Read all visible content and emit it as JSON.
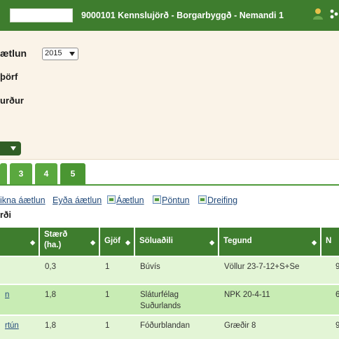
{
  "topbar": {
    "title": "9000101 Kennslujörð - Borgarbyggð - Nemandi 1",
    "user_icon": "user-icon",
    "menu_icon": "menu-icon"
  },
  "panel": {
    "plan_label": "ætlun",
    "year_value": "2015",
    "need_label": "þörf",
    "result_label": "urður"
  },
  "tabs": [
    "3",
    "4",
    "5"
  ],
  "tab_partial": "",
  "links": [
    {
      "label": "ikna áætlun",
      "icon": null
    },
    {
      "label": "Eyða áætlun",
      "icon": null
    },
    {
      "label": "Áætlun",
      "icon": "excel-icon"
    },
    {
      "label": "Pöntun",
      "icon": "excel-icon"
    },
    {
      "label": "Dreifing",
      "icon": "excel-icon"
    }
  ],
  "section_label": "rði",
  "table": {
    "headers": [
      "",
      "Stærð (ha.)",
      "Gjöf",
      "Söluaðili",
      "Tegund",
      "N"
    ],
    "rows": [
      {
        "name": "",
        "size": "0,3",
        "gjof": "1",
        "seller": "Búvís",
        "type": "Völlur 23-7-12+S+Se",
        "n": "9"
      },
      {
        "name": "n",
        "size": "1,8",
        "gjof": "1",
        "seller": "Sláturfélag Suðurlands",
        "type": "NPK 20-4-11",
        "n": "6"
      },
      {
        "name": "rtún",
        "size": "1,8",
        "gjof": "1",
        "seller": "Fóðurblandan",
        "type": "Græðir 8",
        "n": "9"
      }
    ]
  },
  "colors": {
    "header_green": "#3e7d2e",
    "tab_green": "#5aa83f",
    "row_light": "#e3f5d6",
    "row_mid": "#c8ecb4",
    "panel_beige": "#faf3e8"
  }
}
